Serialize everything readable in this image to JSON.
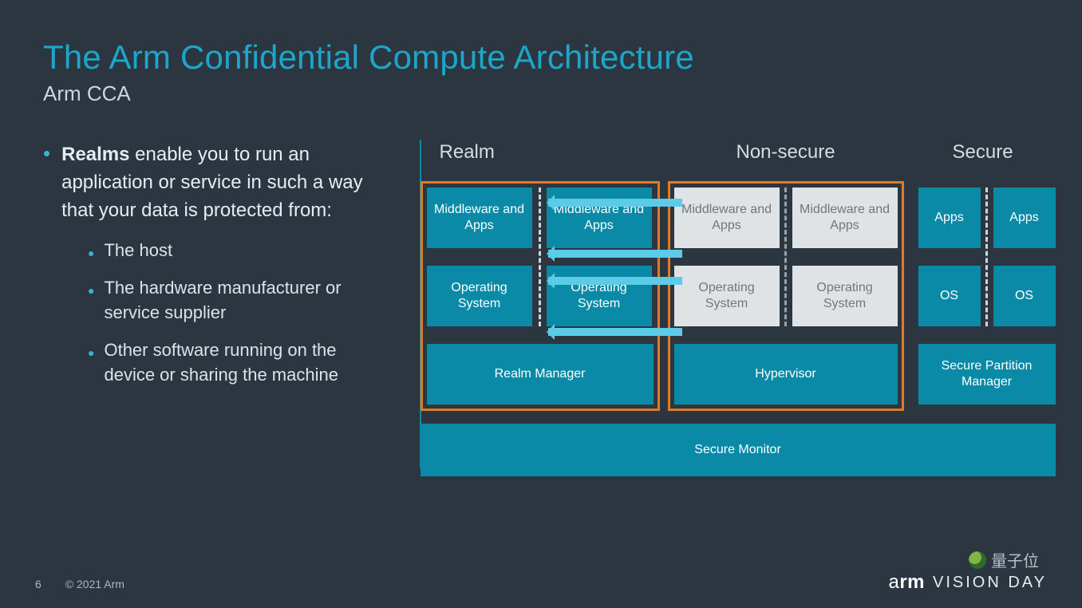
{
  "title": "The Arm Confidential Compute Architecture",
  "subtitle": "Arm CCA",
  "bullet_lead_bold": "Realms",
  "bullet_lead_rest": " enable you to run an application or service in such a way that your data is protected from:",
  "sub_bullets": [
    "The host",
    "The hardware manufacturer or service supplier",
    "Other software running on the device or sharing the machine"
  ],
  "columns": {
    "realm": "Realm",
    "nonsecure": "Non-secure",
    "secure": "Secure"
  },
  "boxes": {
    "realm_mw1": "Middleware and Apps",
    "realm_mw2": "Middleware and Apps",
    "ns_mw1": "Middleware and Apps",
    "ns_mw2": "Middleware and Apps",
    "realm_os1": "Operating System",
    "realm_os2": "Operating System",
    "ns_os1": "Operating System",
    "ns_os2": "Operating System",
    "sec_apps1": "Apps",
    "sec_apps2": "Apps",
    "sec_os1": "OS",
    "sec_os2": "OS",
    "realm_mgr": "Realm Manager",
    "hypervisor": "Hypervisor",
    "spm": "Secure Partition Manager",
    "monitor": "Secure Monitor"
  },
  "footer": {
    "page": "6",
    "copyright": "© 2021 Arm"
  },
  "brand": {
    "arm_light": "a",
    "arm_bold": "rm",
    "tag": "VISION DAY"
  },
  "watermark": "量子位"
}
